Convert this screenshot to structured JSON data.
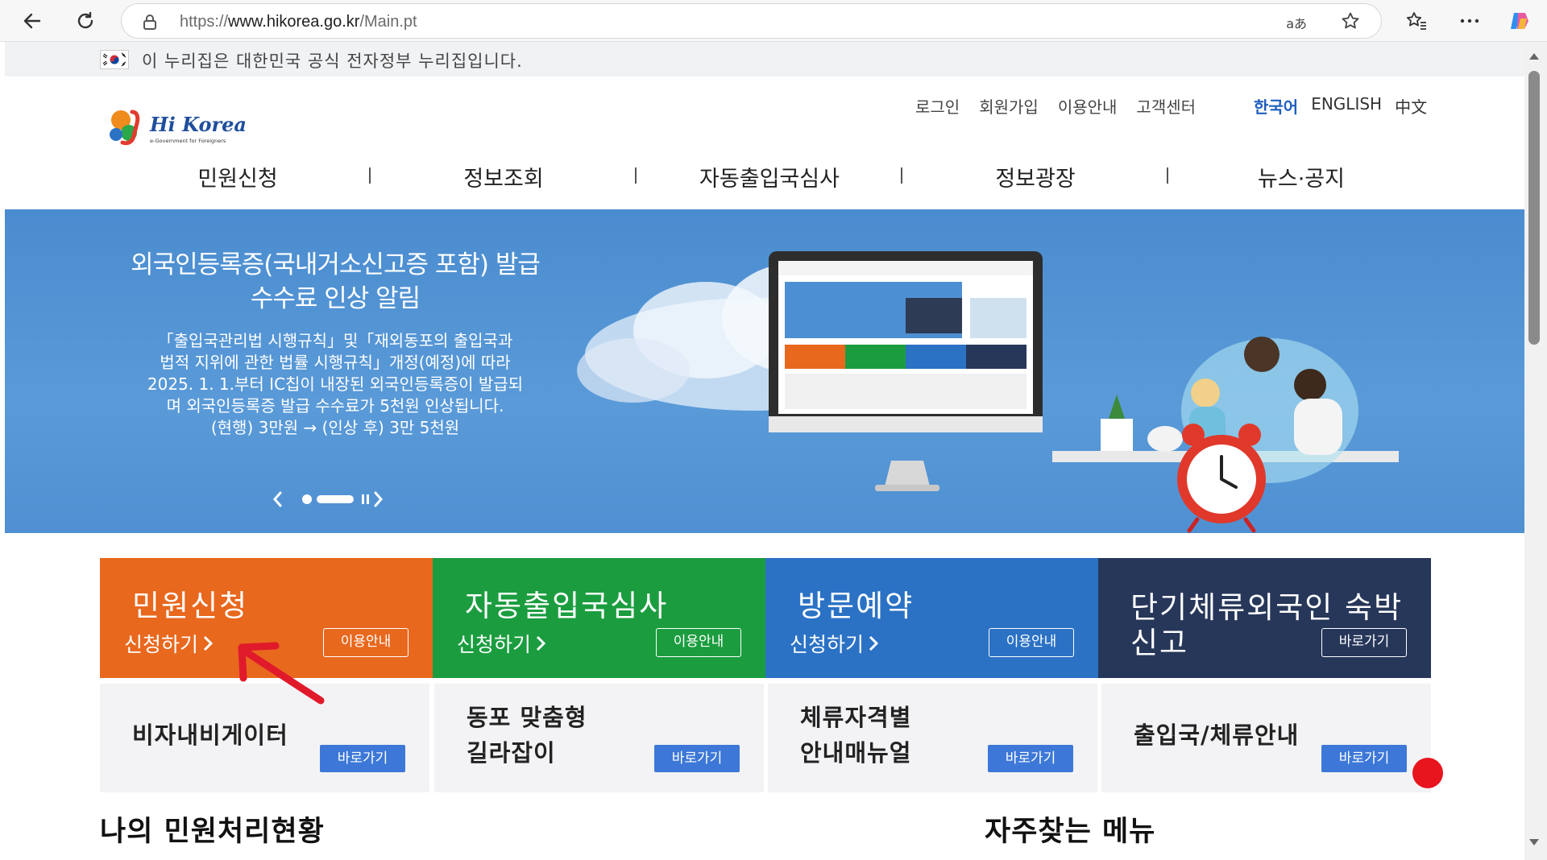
{
  "browser": {
    "url_protocol": "https://",
    "url_host": "www.hikorea.go.kr",
    "url_path": "/Main.pt",
    "reader_label": "aあ"
  },
  "gov_banner": {
    "text": "이 누리집은 대한민국 공식 전자정부 누리집입니다."
  },
  "header": {
    "logo_text": "Hi Korea",
    "logo_subtext": "e-Government for Foreigners",
    "util_links": [
      "로그인",
      "회원가입",
      "이용안내",
      "고객센터"
    ],
    "languages": [
      "한국어",
      "ENGLISH",
      "中文"
    ],
    "gnb": [
      "민원신청",
      "정보조회",
      "자동출입국심사",
      "정보광장",
      "뉴스·공지"
    ]
  },
  "hero": {
    "title_line1": "외국인등록증(국내거소신고증 포함) 발급",
    "title_line2": "수수료 인상 알림",
    "desc_line1": "「출입국관리법 시행규칙」및「재외동포의 출입국과",
    "desc_line2": "법적 지위에 관한 법률 시행규칙」개정(예정)에 따라",
    "desc_line3": "2025. 1. 1.부터 IC칩이 내장된 외국인등록증이 발급되",
    "desc_line4": "며 외국인등록증 발급 수수료가 5천원 인상됩니다.",
    "desc_line5": "(현행) 3만원 → (인상 후) 3만 5천원"
  },
  "service_tiles": [
    {
      "title": "민원신청",
      "link": "신청하기",
      "button": "이용안내",
      "color": "#e8681e"
    },
    {
      "title": "자동출입국심사",
      "link": "신청하기",
      "button": "이용안내",
      "color": "#1b9d3f"
    },
    {
      "title": "방문예약",
      "link": "신청하기",
      "button": "이용안내",
      "color": "#2b72c5"
    },
    {
      "title_line1": "단기체류외국인 숙박",
      "title_line2": "신고",
      "button": "바로가기",
      "color": "#27375a"
    }
  ],
  "quick_cards": [
    {
      "title_line1": "비자내비게이터",
      "button": "바로가기"
    },
    {
      "title_line1": "동포 맞춤형",
      "title_line2": "길라잡이",
      "button": "바로가기"
    },
    {
      "title_line1": "체류자격별",
      "title_line2": "안내매뉴얼",
      "button": "바로가기"
    },
    {
      "title_line1": "출입국/체류안내",
      "button": "바로가기"
    }
  ],
  "sections": {
    "my_status": "나의 민원처리현황",
    "frequent_menu": "자주찾는 메뉴"
  }
}
